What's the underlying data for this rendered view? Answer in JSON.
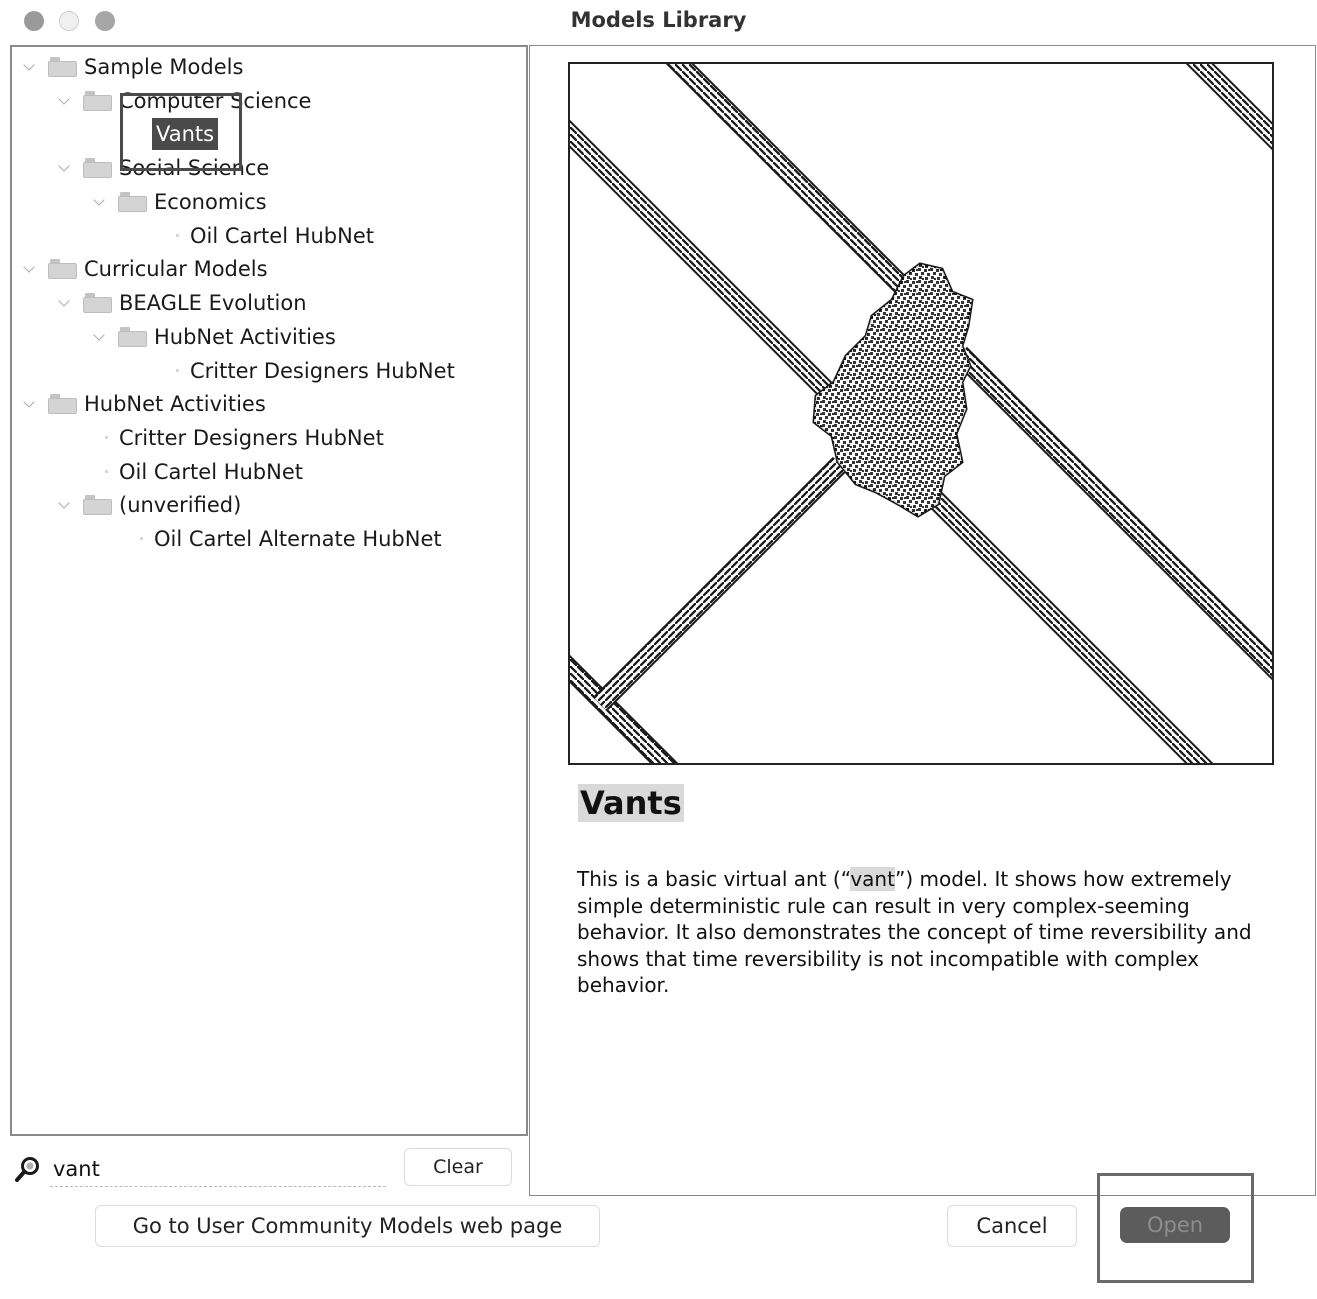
{
  "window": {
    "title": "Models Library"
  },
  "tree": [
    {
      "label": "Sample Models",
      "type": "folder"
    },
    {
      "label": "Computer Science",
      "type": "folder"
    },
    {
      "label": "Vants",
      "type": "model",
      "selected": true
    },
    {
      "label": "Social Science",
      "type": "folder"
    },
    {
      "label": "Economics",
      "type": "folder"
    },
    {
      "label": "Oil Cartel HubNet",
      "type": "model"
    },
    {
      "label": "Curricular Models",
      "type": "folder"
    },
    {
      "label": "BEAGLE Evolution",
      "type": "folder"
    },
    {
      "label": "HubNet Activities",
      "type": "folder"
    },
    {
      "label": "Critter Designers HubNet",
      "type": "model"
    },
    {
      "label": "HubNet Activities",
      "type": "folder"
    },
    {
      "label": "Critter Designers HubNet",
      "type": "model"
    },
    {
      "label": "Oil Cartel HubNet",
      "type": "model"
    },
    {
      "label": "(unverified)",
      "type": "folder"
    },
    {
      "label": "Oil Cartel Alternate HubNet",
      "type": "model"
    }
  ],
  "search": {
    "value": "vant",
    "clear_label": "Clear"
  },
  "preview": {
    "title": "Vants",
    "description_before": "This is a basic virtual ant (“",
    "description_highlight": "vant",
    "description_after": "”) model. It shows how extremely simple deterministic rule can result in very complex-seeming behavior. It also demonstrates the concept of time reversibility and shows that time reversibility is not incompatible with complex behavior."
  },
  "buttons": {
    "community": "Go to User Community Models web page",
    "cancel": "Cancel",
    "open": "Open"
  },
  "colors": {
    "selection": "#4a4a4a",
    "open_button": "#5c5c5c",
    "highlight": "#d9d9d9"
  }
}
